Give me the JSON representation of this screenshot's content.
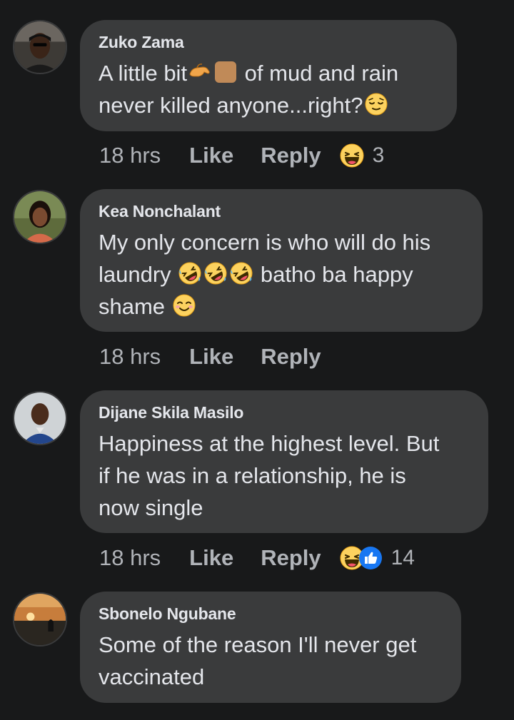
{
  "comments": [
    {
      "author": "Zuko Zama",
      "text_a": "A little bit",
      "text_b": " of mud and rain",
      "text_c": "never killed anyone",
      "text_d": "...right?",
      "time": "18 hrs",
      "like_label": "Like",
      "reply_label": "Reply",
      "reaction_count": "3",
      "reactions": [
        "haha"
      ]
    },
    {
      "author": "Kea Nonchalant",
      "text_a": "My only concern is who will do his",
      "text_b": "laundry",
      "text_c": " batho ba happy",
      "text_d": "shame",
      "time": "18 hrs",
      "like_label": "Like",
      "reply_label": "Reply"
    },
    {
      "author": "Dijane Skila Masilo",
      "text_a": "Happiness at the highest level. But",
      "text_b": "if he was in a relationship, he is",
      "text_c": "now single",
      "time": "18 hrs",
      "like_label": "Like",
      "reply_label": "Reply",
      "reaction_count": "14",
      "reactions": [
        "haha",
        "like"
      ]
    },
    {
      "author": "Sbonelo Ngubane",
      "text_a": "Some of the reason I'll never get",
      "text_b": "vaccinated"
    }
  ],
  "colors": {
    "background": "#18191a",
    "bubble": "#3a3b3c",
    "primary_text": "#e4e6eb",
    "secondary_text": "#b0b3b8",
    "like_blue": "#1877f2",
    "haha_yellow": "#f7b125"
  }
}
